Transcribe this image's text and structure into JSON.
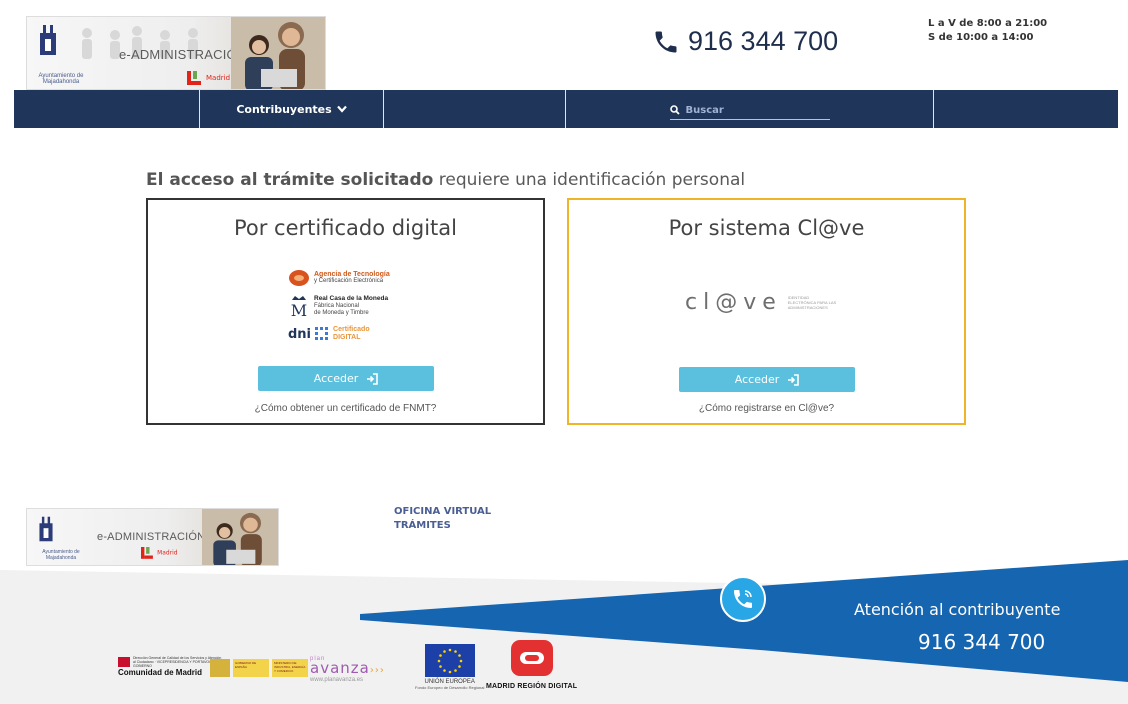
{
  "header": {
    "banner": {
      "ayuntamiento": "Ayuntamiento de Majadahonda",
      "eadmin": "e-ADMINISTRACIÓN",
      "madrid": "Madrid"
    },
    "phone": "916 344 700",
    "hours": [
      "L a V de 8:00 a 21:00",
      "S de 10:00 a 14:00"
    ]
  },
  "nav": {
    "menu_label": "Contribuyentes",
    "search_placeholder": "Buscar"
  },
  "main": {
    "heading_bold": "El acceso al trámite solicitado",
    "heading_rest": " requiere una identificación personal",
    "cert": {
      "title": "Por certificado digital",
      "logos": {
        "aceti_1": "Agencia de Tecnología",
        "aceti_2": "y Certificación Electrónica",
        "fnmt_1": "Real Casa de la Moneda",
        "fnmt_2": "Fábrica Nacional",
        "fnmt_3": "de Moneda y Timbre",
        "dni": "dni",
        "cert_1": "Certificado",
        "cert_2": "DIGITAL"
      },
      "button": "Acceder",
      "help": "¿Cómo obtener un certificado de FNMT?"
    },
    "clave": {
      "title": "Por sistema Cl@ve",
      "logo_text": "cl@ve",
      "logo_sub": "IDENTIDAD ELECTRÓNICA PARA LAS ADMINISTRACIONES",
      "button": "Acceder",
      "help": "¿Cómo registrarse en Cl@ve?"
    }
  },
  "footer": {
    "links": [
      "OFICINA VIRTUAL",
      "TRÁMITES"
    ],
    "atencion_label": "Atención al contribuyente",
    "atencion_phone": "916 344 700",
    "cm_small": "Dirección General de Calidad de los Servicios y Atención al Ciudadano · VICEPRESIDENCIA Y PORTAVOCÍA DEL GOBIERNO",
    "cm_big": "Comunidad de Madrid",
    "gob_1": "GOBIERNO DE ESPAÑA",
    "gob_2": "MINISTERIO DE INDUSTRIA, ENERGÍA Y COMERCIO",
    "planavanza_plan": "plan",
    "planavanza_name": "avanza",
    "planavanza_www": "www.planavanza.es",
    "ue": "UNIÓN EUROPEA",
    "ue_sub": "Fondo Europeo de Desarrollo Regional",
    "mrd": "MADRID REGIÓN DIGITAL"
  },
  "colors": {
    "nav_bg": "#1f3559",
    "button": "#5bc0de",
    "clave_border": "#f0b428",
    "footer_blue": "#1565b0",
    "call_icon": "#29a6e6"
  }
}
